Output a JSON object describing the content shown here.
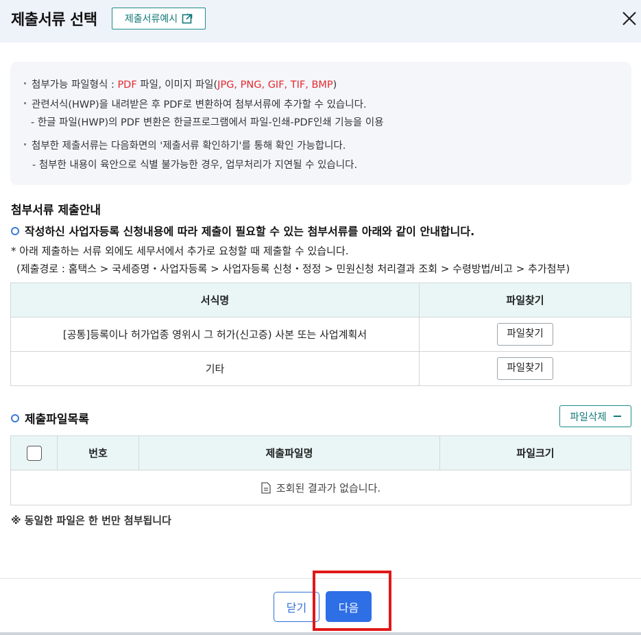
{
  "header": {
    "title": "제출서류 선택",
    "example_button": "제출서류예시"
  },
  "notice": {
    "line1_prefix": "첨부가능 파일형식 : ",
    "line1_pdf": "PDF",
    "line1_mid": " 파일, 이미지 파일(",
    "line1_formats": "JPG, PNG, GIF, TIF, BMP",
    "line1_suffix": ")",
    "line2": "관련서식(HWP)을 내려받은 후 PDF로 변환하여 첨부서류에 추가할 수 있습니다.",
    "line3": "- 한글 파일(HWP)의 PDF 변환은 한글프로그램에서 파일-인쇄-PDF인쇄 기능을 이용",
    "line4": "첨부한 제출서류는 다음화면의 '제출서류 확인하기'를 통해 확인 가능합니다.",
    "line5": "- 첨부한 내용이 육안으로 식별 불가능한 경우, 업무처리가 지연될 수 있습니다."
  },
  "guide": {
    "section_title": "첨부서류 제출안내",
    "line1": "작성하신 사업자등록 신청내용에 따라 제출이 필요할 수 있는 첨부서류를 아래와 같이 안내합니다.",
    "line2": "* 아래 제출하는 서류 외에도 세무서에서 추가로 요청할 때 제출할 수 있습니다.",
    "line3": "(제출경로 : 홈택스 > 국세증명・사업자등록 > 사업자등록 신청・정정 > 민원신청 처리결과 조회 > 수령방법/비고 > 추가첨부)"
  },
  "doc_table": {
    "headers": [
      "서식명",
      "파일찾기"
    ],
    "rows": [
      {
        "name": "[공통]등록이나 허가업종 영위시 그 허가(신고증) 사본 또는 사업계획서",
        "button": "파일찾기"
      },
      {
        "name": "기타",
        "button": "파일찾기"
      }
    ]
  },
  "files": {
    "title": "제출파일목록",
    "delete_button": "파일삭제",
    "headers": [
      "번호",
      "제출파일명",
      "파일크기"
    ],
    "empty_message": "조회된 결과가 없습니다."
  },
  "note": "※ 동일한 파일은 한 번만 첨부됩니다",
  "footer": {
    "close_button": "닫기",
    "next_button": "다음"
  },
  "colors": {
    "accent": "#2f6fe6",
    "teal": "#137878",
    "red": "#e5282e",
    "highlight": "#e01818"
  }
}
